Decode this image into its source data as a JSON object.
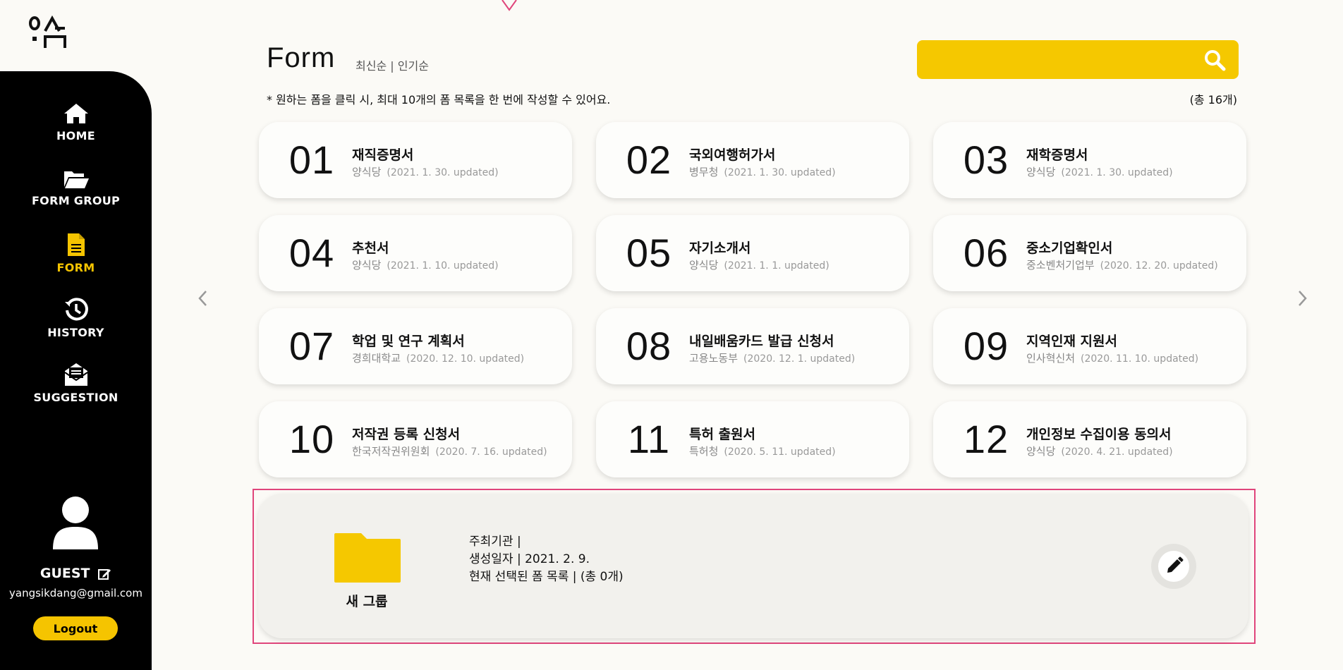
{
  "sidebar": {
    "items": [
      {
        "label": "HOME",
        "icon": "home-icon"
      },
      {
        "label": "FORM GROUP",
        "icon": "folder-open-icon"
      },
      {
        "label": "FORM",
        "icon": "document-icon",
        "active": true
      },
      {
        "label": "HISTORY",
        "icon": "history-icon"
      },
      {
        "label": "SUGGESTION",
        "icon": "mail-envelope-icon"
      }
    ],
    "user": {
      "name": "GUEST",
      "email": "yangsikdang@gmail.com"
    },
    "logout_label": "Logout"
  },
  "header": {
    "title": "Form",
    "sort_latest": "최신순",
    "sort_divider": "|",
    "sort_popular": "인기순",
    "search": {
      "placeholder": "",
      "value": ""
    },
    "hint": "* 원하는 폼을 클릭 시, 최대 10개의 폼 목록을 한 번에 작성할 수 있어요.",
    "total": "(총 16개)"
  },
  "forms": [
    {
      "num": "01",
      "title": "재직증명서",
      "org": "양식당",
      "date": "(2021. 1. 30. updated)"
    },
    {
      "num": "02",
      "title": "국외여행허가서",
      "org": "병무청",
      "date": "(2021. 1. 30. updated)"
    },
    {
      "num": "03",
      "title": "재학증명서",
      "org": "양식당",
      "date": "(2021. 1. 30. updated)"
    },
    {
      "num": "04",
      "title": "추천서",
      "org": "양식당",
      "date": "(2021. 1. 10. updated)"
    },
    {
      "num": "05",
      "title": "자기소개서",
      "org": "양식당",
      "date": "(2021. 1. 1. updated)"
    },
    {
      "num": "06",
      "title": "중소기업확인서",
      "org": "중소벤처기업부",
      "date": "(2020. 12. 20. updated)"
    },
    {
      "num": "07",
      "title": "학업 및 연구 계획서",
      "org": "경희대학교",
      "date": "(2020. 12. 10. updated)"
    },
    {
      "num": "08",
      "title": "내일배움카드 발급 신청서",
      "org": "고용노동부",
      "date": "(2020. 12. 1. updated)"
    },
    {
      "num": "09",
      "title": "지역인재 지원서",
      "org": "인사혁신처",
      "date": "(2020. 11. 10. updated)"
    },
    {
      "num": "10",
      "title": "저작권 등록 신청서",
      "org": "한국저작권위원회",
      "date": "(2020. 7. 16. updated)"
    },
    {
      "num": "11",
      "title": "특허 출원서",
      "org": "특허청",
      "date": "(2020. 5. 11. updated)"
    },
    {
      "num": "12",
      "title": "개인정보 수집이용 동의서",
      "org": "양식당",
      "date": "(2020. 4. 21. updated)"
    }
  ],
  "group": {
    "name": "새 그룹",
    "host_label": "주최기관 |",
    "created_label": "생성일자 |",
    "created_value": "2021. 2. 9.",
    "selected_label": "현재 선택된 폼 목록 | (총 0개)"
  },
  "colors": {
    "accent": "#f5c400",
    "sidebar": "#000000",
    "highlight": "#e0457b"
  }
}
